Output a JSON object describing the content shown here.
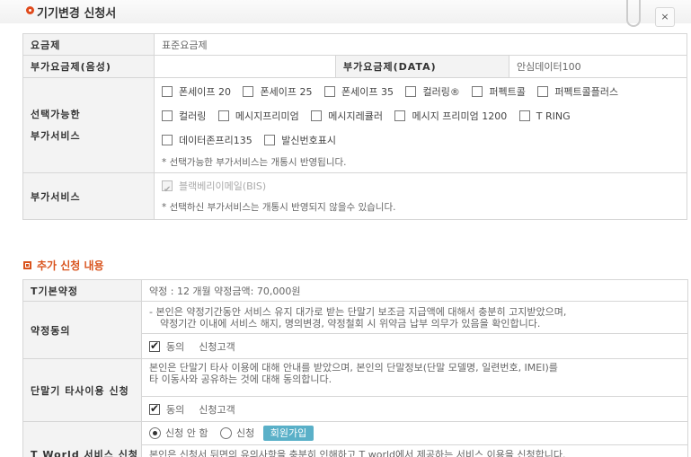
{
  "window": {
    "title": "기기변경 신청서",
    "close_label": "×"
  },
  "plan": {
    "label": "요금제",
    "value": "표준요금제"
  },
  "addon_fees": {
    "voice_label": "부가요금제(음성)",
    "voice_value": "",
    "data_label": "부가요금제(DATA)",
    "data_value": "안심데이터100"
  },
  "selectable": {
    "label_line1": "선택가능한",
    "label_line2": "부가서비스",
    "rows": [
      [
        "폰세이프 20",
        "폰세이프 25",
        "폰세이프 35",
        "컬러링®",
        "퍼펙트콜",
        "퍼펙트콜플러스"
      ],
      [
        "컬러링",
        "메시지프리미엄",
        "메시지레큘러",
        "메시지 프리미엄 1200",
        "T RING"
      ],
      [
        "데이터존프리135",
        "발신번호표시"
      ]
    ],
    "note": "* 선택가능한 부가서비스는 개통시 반영됩니다."
  },
  "addon_service": {
    "label": "부가서비스",
    "item": "블랙베리이메일(BIS)",
    "note": "* 선택하신 부가서비스는 개통시 반영되지 않을수 있습니다."
  },
  "section": {
    "title": "추가 신청 내용"
  },
  "contract": {
    "label": "T기본약정",
    "value": "약정 : 12 개월 약정금액: 70,000원"
  },
  "agreement": {
    "label": "약정동의",
    "line1": "- 본인은 약정기간동안 서비스 유지 대가로 받는 단말기 보조금 지급액에 대해서 충분히 고지받았으며,",
    "line2": "약정기간 이내에 서비스 해지, 명의변경, 약정철회 시 위약금 납부 의무가 있음을 확인합니다.",
    "agree_label": "동의",
    "applicant": "신청고객"
  },
  "device_use": {
    "label": "단말기 타사이용 신청",
    "line1": "본인은 단말기 타사 이용에 대해 안내를 받았으며, 본인의 단말정보(단말 모델명, 일련번호, IMEI)를",
    "line2": "타 이동사와 공유하는 것에 대해 동의합니다.",
    "agree_label": "동의",
    "applicant": "신청고객"
  },
  "tworld": {
    "label": "T World 서비스 신청",
    "no_apply": "신청 안 함",
    "apply": "신청",
    "join_button": "회원가입",
    "line1": "본인은 신청서 뒤면의 유의사항을 충분히 인해하고 T world에서 제공하는 서비스 이용을 신청합니다."
  }
}
